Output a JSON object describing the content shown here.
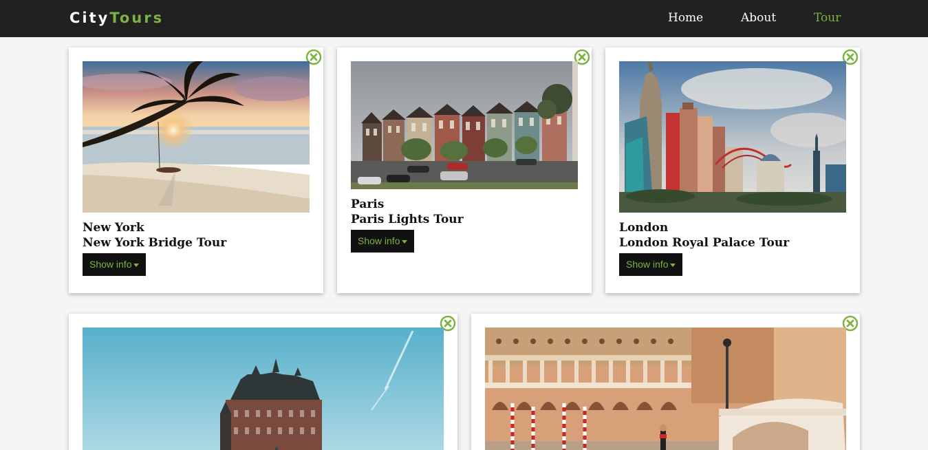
{
  "brand": {
    "part1": "City",
    "part2": "Tours"
  },
  "nav": {
    "items": [
      {
        "label": "Home"
      },
      {
        "label": "About"
      },
      {
        "label": "Tour"
      }
    ],
    "active": "Tour"
  },
  "tours": [
    {
      "city": "New York",
      "name": "New York Bridge Tour",
      "button": "Show info"
    },
    {
      "city": "Paris",
      "name": "Paris Lights Tour",
      "button": "Show info"
    },
    {
      "city": "London",
      "name": "London Royal Palace Tour",
      "button": "Show info"
    },
    {
      "city": "",
      "name": "",
      "button": ""
    },
    {
      "city": "",
      "name": "",
      "button": ""
    }
  ],
  "colors": {
    "accent": "#7cb342",
    "navbar": "#212121",
    "button_bg": "#111111",
    "page_bg": "#f5f5f5"
  },
  "icons": {
    "close": "close-circle-icon",
    "caret": "caret-down-icon"
  }
}
